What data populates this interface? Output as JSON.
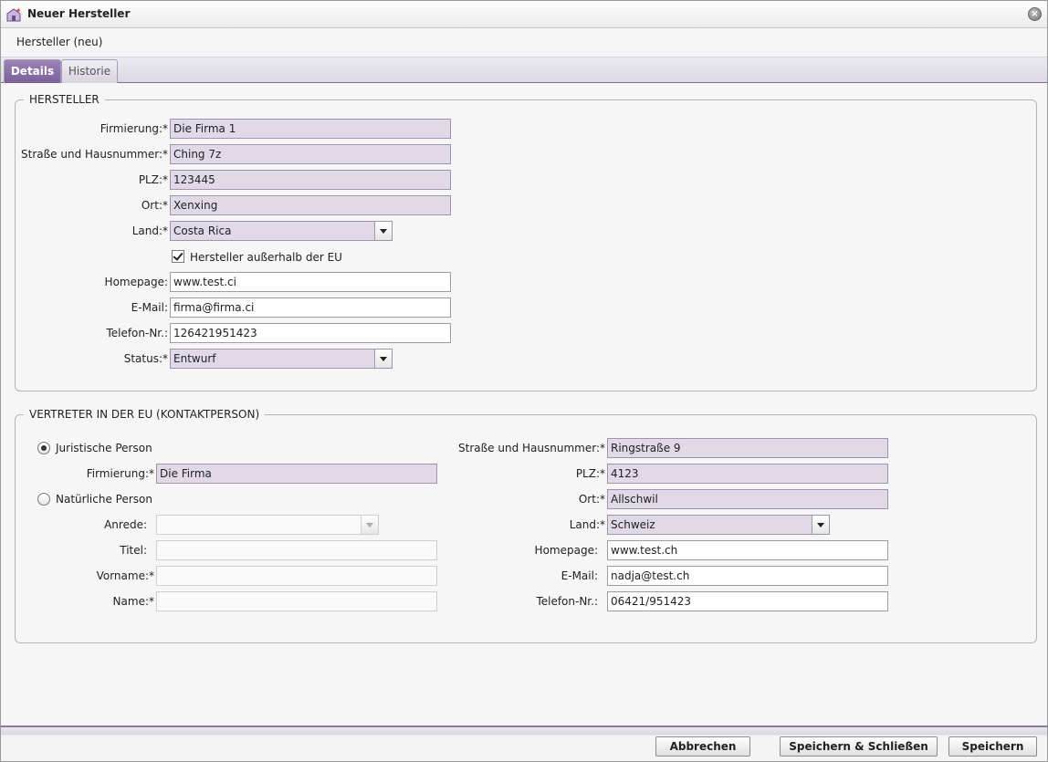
{
  "window": {
    "title": "Neuer Hersteller",
    "close_icon": "×"
  },
  "record_title": "Hersteller (neu)",
  "tabs": [
    {
      "label": "Details",
      "active": true
    },
    {
      "label": "Historie",
      "active": false
    }
  ],
  "hersteller": {
    "legend": "HERSTELLER",
    "firmierung": {
      "label": "Firmierung:*",
      "value": "Die Firma 1"
    },
    "strasse": {
      "label": "Straße und Hausnummer:*",
      "value": "Ching 7z"
    },
    "plz": {
      "label": "PLZ:*",
      "value": "123445"
    },
    "ort": {
      "label": "Ort:*",
      "value": "Xenxing"
    },
    "land": {
      "label": "Land:*",
      "value": "Costa Rica"
    },
    "ausserhalb_eu": {
      "label": "Hersteller außerhalb der EU",
      "checked": true
    },
    "homepage": {
      "label": "Homepage:",
      "value": "www.test.ci"
    },
    "email": {
      "label": "E-Mail:",
      "value": "firma@firma.ci"
    },
    "telefon": {
      "label": "Telefon-Nr.:",
      "value": "126421951423"
    },
    "status": {
      "label": "Status:*",
      "value": "Entwurf"
    }
  },
  "vertreter": {
    "legend": "VERTRETER IN DER EU (KONTAKTPERSON)",
    "juristische_person": {
      "label": "Juristische Person",
      "checked": true
    },
    "firmierung": {
      "label": "Firmierung:*",
      "value": "Die Firma"
    },
    "natuerliche_person": {
      "label": "Natürliche Person",
      "checked": false
    },
    "anrede": {
      "label": "Anrede:",
      "value": ""
    },
    "titel": {
      "label": "Titel:",
      "value": ""
    },
    "vorname": {
      "label": "Vorname:*",
      "value": ""
    },
    "name": {
      "label": "Name:*",
      "value": ""
    },
    "strasse": {
      "label": "Straße und Hausnummer:*",
      "value": "Ringstraße 9"
    },
    "plz": {
      "label": "PLZ:*",
      "value": "4123"
    },
    "ort": {
      "label": "Ort:*",
      "value": "Allschwil"
    },
    "land": {
      "label": "Land:*",
      "value": "Schweiz"
    },
    "homepage": {
      "label": "Homepage:",
      "value": "www.test.ch"
    },
    "email": {
      "label": "E-Mail:",
      "value": "nadja@test.ch"
    },
    "telefon": {
      "label": "Telefon-Nr.:",
      "value": "06421/951423"
    }
  },
  "footer": {
    "cancel_label": "Abbrechen",
    "save_close_label": "Speichern & Schließen",
    "save_label": "Speichern"
  },
  "colors": {
    "accent": "#7a5f99",
    "required_field_bg": "#e1d9e8"
  }
}
